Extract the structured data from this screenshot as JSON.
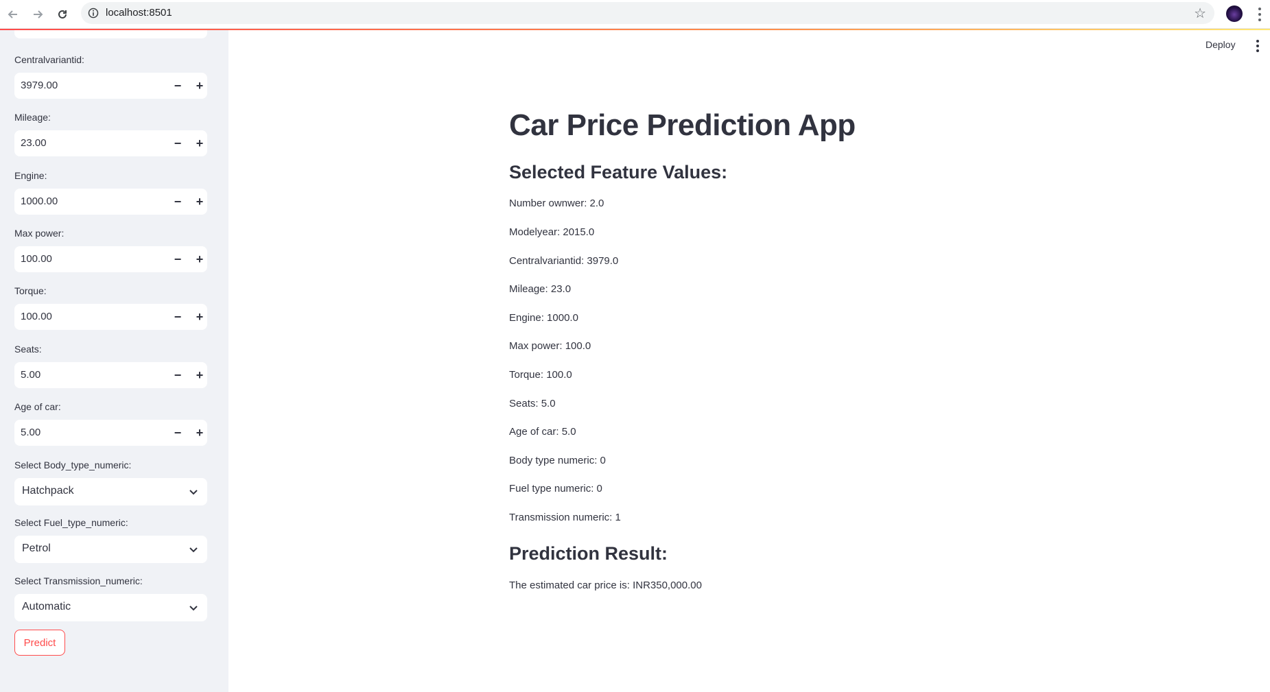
{
  "browser": {
    "url": "localhost:8501"
  },
  "header": {
    "deploy_label": "Deploy"
  },
  "sidebar": {
    "number_inputs": [
      {
        "label": "Centralvariantid:",
        "value": "3979.00"
      },
      {
        "label": "Mileage:",
        "value": "23.00"
      },
      {
        "label": "Engine:",
        "value": "1000.00"
      },
      {
        "label": "Max power:",
        "value": "100.00"
      },
      {
        "label": "Torque:",
        "value": "100.00"
      },
      {
        "label": "Seats:",
        "value": "5.00"
      },
      {
        "label": "Age of car:",
        "value": "5.00"
      }
    ],
    "selects": [
      {
        "label": "Select Body_type_numeric:",
        "value": "Hatchpack"
      },
      {
        "label": "Select Fuel_type_numeric:",
        "value": "Petrol"
      },
      {
        "label": "Select Transmission_numeric:",
        "value": "Automatic"
      }
    ],
    "step_minus": "−",
    "step_plus": "+",
    "predict_label": "Predict"
  },
  "main": {
    "title": "Car Price Prediction App",
    "features_header": "Selected Feature Values:",
    "features": [
      "Number ownwer: 2.0",
      "Modelyear: 2015.0",
      "Centralvariantid: 3979.0",
      "Mileage: 23.0",
      "Engine: 1000.0",
      "Max power: 100.0",
      "Torque: 100.0",
      "Seats: 5.0",
      "Age of car: 5.0",
      "Body type numeric: 0",
      "Fuel type numeric: 0",
      "Transmission numeric: 1"
    ],
    "result_header": "Prediction Result:",
    "result_text": "The estimated car price is: INR350,000.00"
  }
}
